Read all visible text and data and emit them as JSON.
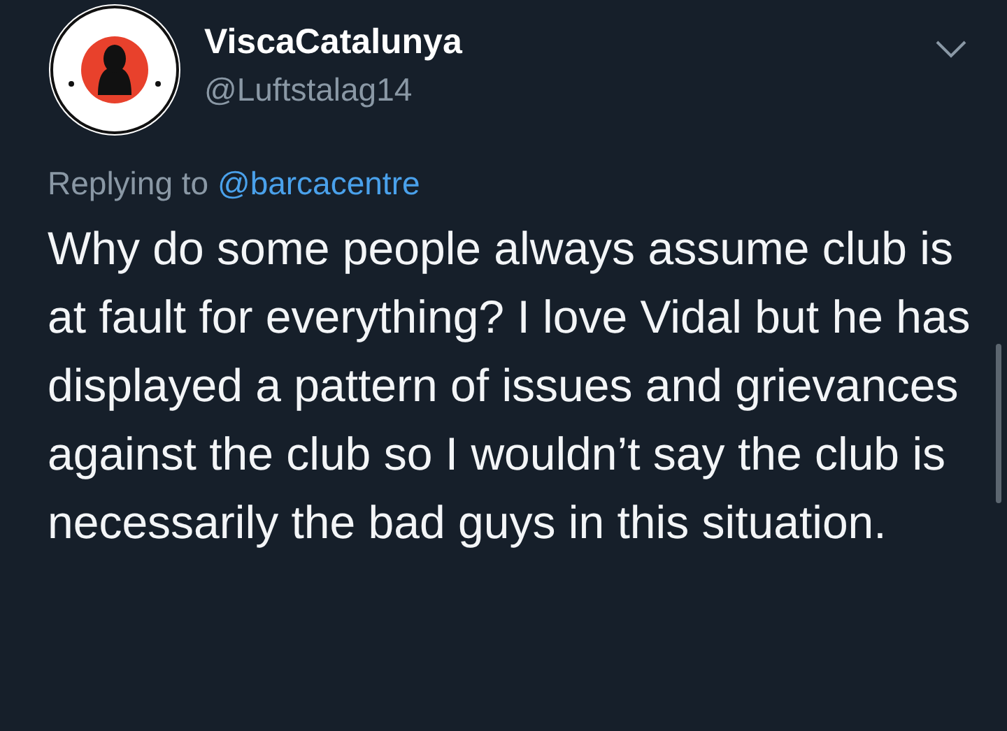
{
  "tweet": {
    "display_name": "ViscaCatalunya",
    "handle": "@Luftstalag14",
    "reply_prefix": "Replying to",
    "reply_to": "@barcacentre",
    "body": "Why do some people always assume club is at fault for everything? I love Vidal but he has displayed a pattern of issues and grievances against the club so I wouldn’t say the club is necessarily the bad guys in this situation."
  }
}
